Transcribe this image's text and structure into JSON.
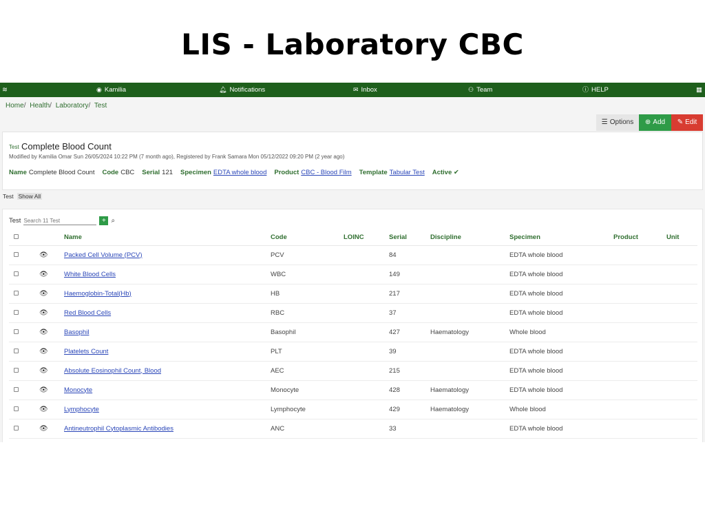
{
  "slide": {
    "title": "LIS - Laboratory CBC"
  },
  "topbar": {
    "user": "Kamilia",
    "notifications": "Notifications",
    "inbox": "Inbox",
    "team": "Team",
    "help": "HELP"
  },
  "breadcrumb": [
    "Home",
    "Health",
    "Laboratory",
    "Test"
  ],
  "actions": {
    "options": "Options",
    "add": "Add",
    "edit": "Edit"
  },
  "record": {
    "type_label": "Test",
    "title": "Complete Blood Count",
    "meta": "Modified by Kamilia Omar Sun 26/05/2024 10:22 PM (7 month ago), Registered by Frank Samara Mon 05/12/2022 09:20 PM (2 year ago)",
    "fields": {
      "name_label": "Name",
      "name": "Complete Blood Count",
      "code_label": "Code",
      "code": "CBC",
      "serial_label": "Serial",
      "serial": "121",
      "specimen_label": "Specimen",
      "specimen": "EDTA whole blood",
      "product_label": "Product",
      "product": "CBC - Blood Film",
      "template_label": "Template",
      "template": "Tabular Test",
      "active_label": "Active ✔"
    }
  },
  "subtabs": {
    "tab1": "Test",
    "tab2": "Show All"
  },
  "list": {
    "search_label": "Test",
    "search_placeholder": "Search 11 Test",
    "columns": [
      "Name",
      "Code",
      "LOINC",
      "Serial",
      "Discipline",
      "Specimen",
      "Product",
      "Unit"
    ],
    "rows": [
      {
        "name": "Packed Cell Volume (PCV)",
        "code": "PCV",
        "loinc": "",
        "serial": "84",
        "discipline": "",
        "specimen": "EDTA whole blood",
        "product": "",
        "unit": ""
      },
      {
        "name": "White Blood Cells",
        "code": "WBC",
        "loinc": "",
        "serial": "149",
        "discipline": "",
        "specimen": "EDTA whole blood",
        "product": "",
        "unit": ""
      },
      {
        "name": "Haemoglobin-Total(Hb)",
        "code": "HB",
        "loinc": "",
        "serial": "217",
        "discipline": "",
        "specimen": "EDTA whole blood",
        "product": "",
        "unit": ""
      },
      {
        "name": "Red Blood Cells",
        "code": "RBC",
        "loinc": "",
        "serial": "37",
        "discipline": "",
        "specimen": "EDTA whole blood",
        "product": "",
        "unit": ""
      },
      {
        "name": "Basophil",
        "code": "Basophil",
        "loinc": "",
        "serial": "427",
        "discipline": "Haematology",
        "specimen": "Whole blood",
        "product": "",
        "unit": ""
      },
      {
        "name": "Platelets Count",
        "code": "PLT",
        "loinc": "",
        "serial": "39",
        "discipline": "",
        "specimen": "EDTA whole blood",
        "product": "",
        "unit": ""
      },
      {
        "name": "Absolute Eosinophil Count, Blood",
        "code": "AEC",
        "loinc": "",
        "serial": "215",
        "discipline": "",
        "specimen": "EDTA whole blood",
        "product": "",
        "unit": ""
      },
      {
        "name": "Monocyte",
        "code": "Monocyte",
        "loinc": "",
        "serial": "428",
        "discipline": "Haematology",
        "specimen": "EDTA whole blood",
        "product": "",
        "unit": ""
      },
      {
        "name": "Lymphocyte",
        "code": "Lymphocyte",
        "loinc": "",
        "serial": "429",
        "discipline": "Haematology",
        "specimen": "Whole blood",
        "product": "",
        "unit": ""
      },
      {
        "name": "Antineutrophil Cytoplasmic Antibodies",
        "code": "ANC",
        "loinc": "",
        "serial": "33",
        "discipline": "",
        "specimen": "EDTA whole blood",
        "product": "",
        "unit": ""
      }
    ]
  },
  "colors": {
    "topbar": "#1e5f1c",
    "accent_green": "#2f6e2f",
    "add": "#2e9b47",
    "edit": "#d83c31",
    "link": "#2a46b8"
  }
}
